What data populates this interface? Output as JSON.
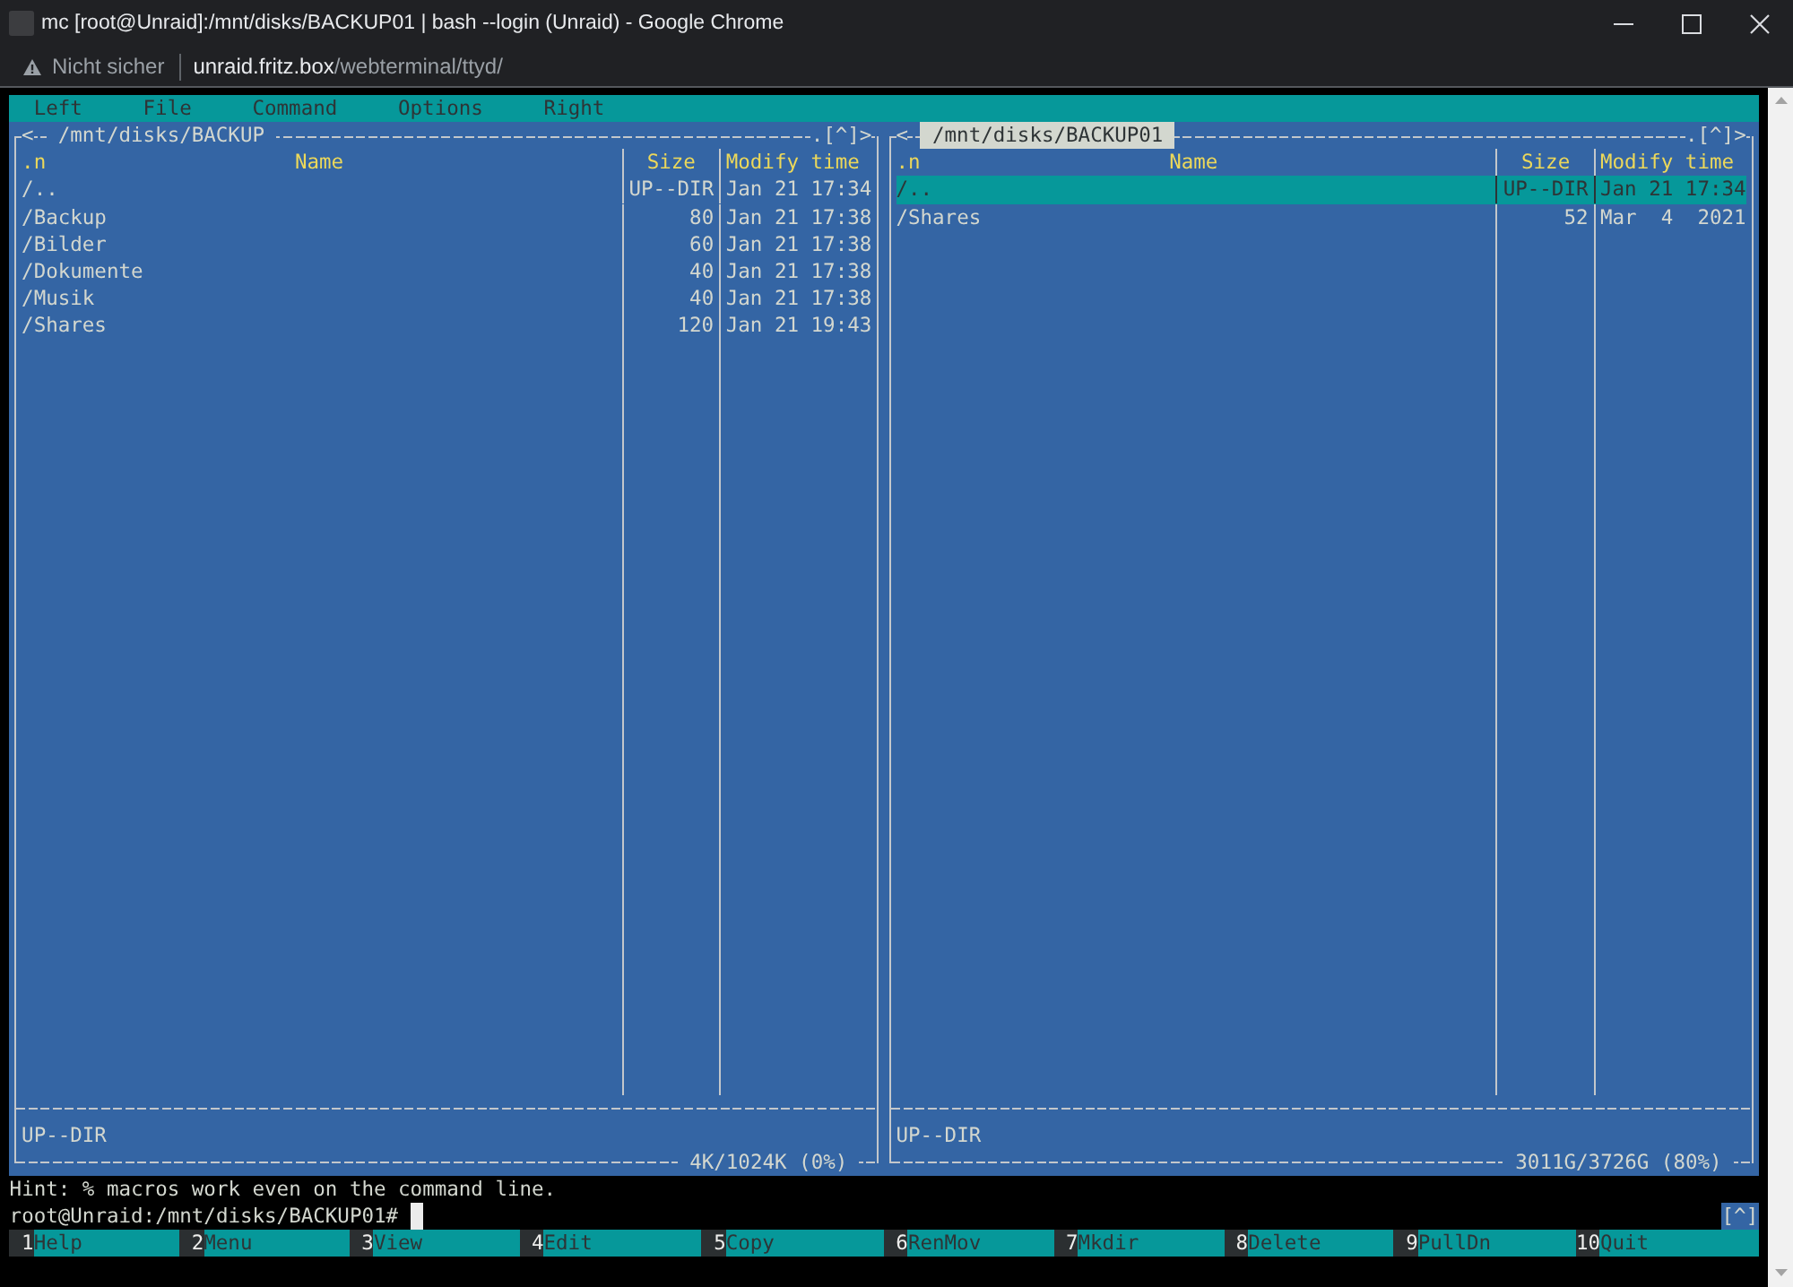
{
  "window": {
    "title": "mc [root@Unraid]:/mnt/disks/BACKUP01 | bash --login (Unraid) - Google Chrome"
  },
  "address_bar": {
    "security_label": "Nicht sicher",
    "url_host": "unraid.fritz.box",
    "url_path": "/webterminal/ttyd/"
  },
  "menu_bar": [
    {
      "label": "Left"
    },
    {
      "label": "File"
    },
    {
      "label": "Command"
    },
    {
      "label": "Options"
    },
    {
      "label": "Right"
    }
  ],
  "panels": [
    {
      "active": false,
      "back": "<",
      "path": "/mnt/disks/BACKUP",
      "hidden_toggle": ".",
      "history": "[^]",
      "forward": ">",
      "sort_indicator": ".n",
      "columns": [
        "Name",
        "Size",
        "Modify time"
      ],
      "rows": [
        {
          "name": "/..",
          "size": "UP--DIR",
          "modified": "Jan 21 17:34",
          "selected": false
        },
        {
          "name": "/Backup",
          "size": "80",
          "modified": "Jan 21 17:38",
          "selected": false
        },
        {
          "name": "/Bilder",
          "size": "60",
          "modified": "Jan 21 17:38",
          "selected": false
        },
        {
          "name": "/Dokumente",
          "size": "40",
          "modified": "Jan 21 17:38",
          "selected": false
        },
        {
          "name": "/Musik",
          "size": "40",
          "modified": "Jan 21 17:38",
          "selected": false
        },
        {
          "name": "/Shares",
          "size": "120",
          "modified": "Jan 21 19:43",
          "selected": false
        }
      ],
      "mini_status": "UP--DIR",
      "disk_usage": "4K/1024K (0%)"
    },
    {
      "active": true,
      "back": "<",
      "path": "/mnt/disks/BACKUP01",
      "hidden_toggle": ".",
      "history": "[^]",
      "forward": ">",
      "sort_indicator": ".n",
      "columns": [
        "Name",
        "Size",
        "Modify time"
      ],
      "rows": [
        {
          "name": "/..",
          "size": "UP--DIR",
          "modified": "Jan 21 17:34",
          "selected": true
        },
        {
          "name": "/Shares",
          "size": "52",
          "modified": "Mar  4  2021",
          "selected": false
        }
      ],
      "mini_status": "UP--DIR",
      "disk_usage": "3011G/3726G (80%)"
    }
  ],
  "hint": "Hint: % macros work even on the command line.",
  "command_line": {
    "prompt": "root@Unraid:/mnt/disks/BACKUP01#",
    "history": "[^]"
  },
  "function_keys": [
    {
      "number": "1",
      "label": "Help"
    },
    {
      "number": "2",
      "label": "Menu"
    },
    {
      "number": "3",
      "label": "View"
    },
    {
      "number": "4",
      "label": "Edit"
    },
    {
      "number": "5",
      "label": "Copy"
    },
    {
      "number": "6",
      "label": "RenMov"
    },
    {
      "number": "7",
      "label": "Mkdir"
    },
    {
      "number": "8",
      "label": "Delete"
    },
    {
      "number": "9",
      "label": "PullDn"
    },
    {
      "number": "10",
      "label": "Quit"
    }
  ]
}
